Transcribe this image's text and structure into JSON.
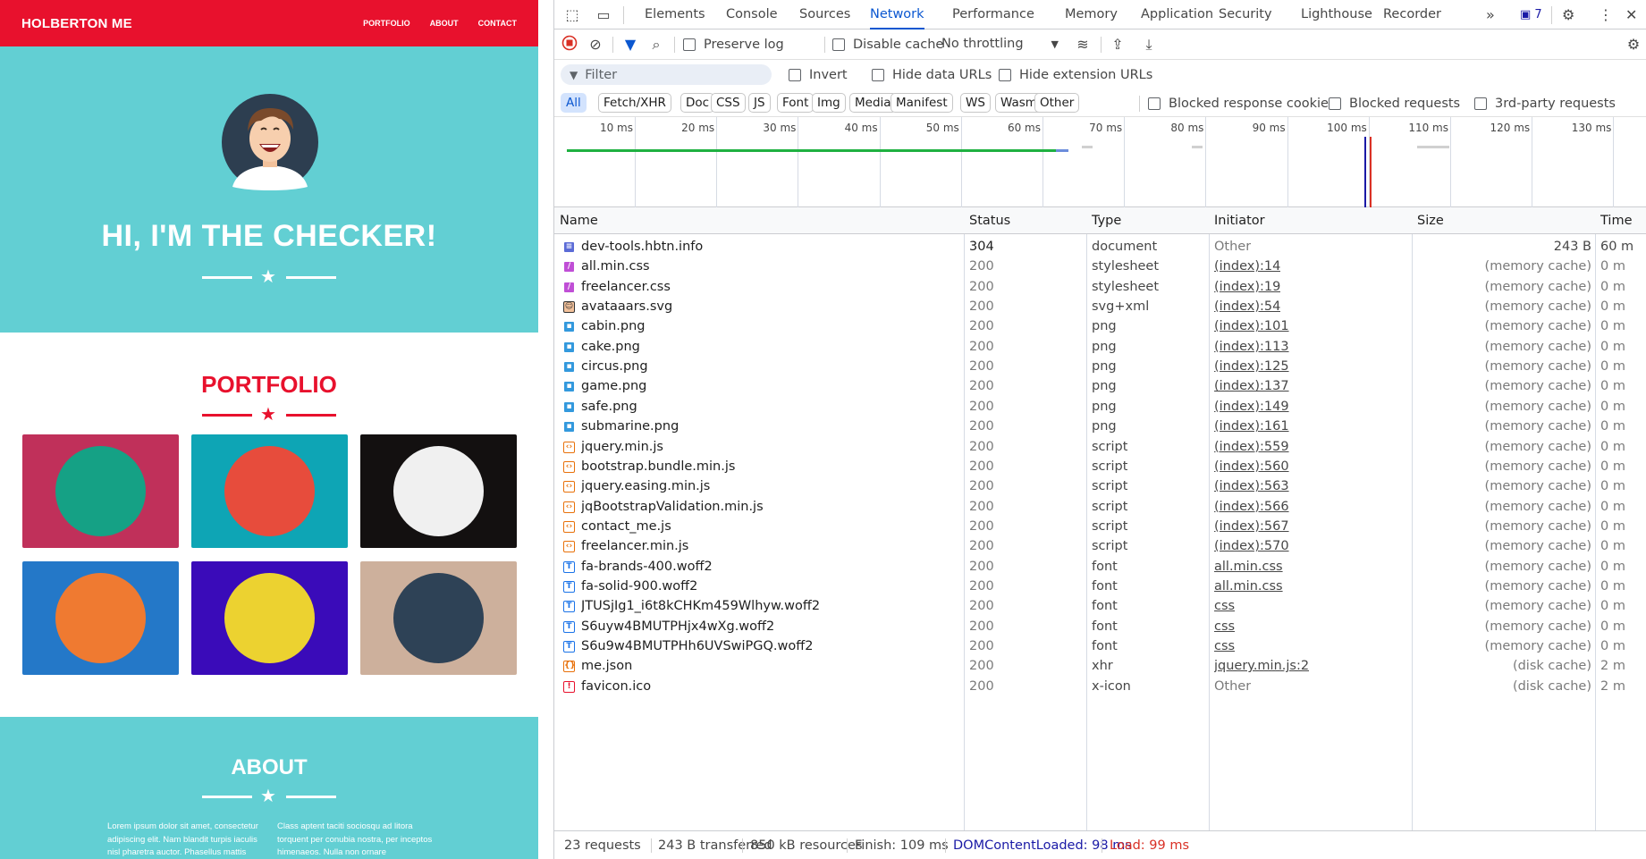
{
  "site": {
    "brand": "HOLBERTON ME",
    "nav": [
      "PORTFOLIO",
      "ABOUT",
      "CONTACT"
    ],
    "hero_title": "HI, I'M THE CHECKER!",
    "portfolio_title": "PORTFOLIO",
    "about_title": "ABOUT",
    "about_col1": "Lorem ipsum dolor sit amet, consectetur adipiscing elit. Nam blandit turpis iaculis nisl pharetra auctor. Phasellus mattis",
    "about_col2": "Class aptent taciti sociosqu ad litora torquent per conubia nostra, per inceptos himenaeos. Nulla non ornare",
    "colors": {
      "nav": "#e8112d",
      "teal": "#62cfd3",
      "accent": "#e8112d"
    },
    "tiles": [
      {
        "name": "cabin",
        "bg": "#c0305a",
        "circle": "#15a185"
      },
      {
        "name": "cake",
        "bg": "#0ea5b5",
        "circle": "#e74c3c"
      },
      {
        "name": "circus",
        "bg": "#131010",
        "circle": "#f0f0f0"
      },
      {
        "name": "game",
        "bg": "#2478c8",
        "circle": "#ef7a31"
      },
      {
        "name": "safe",
        "bg": "#3a0bb9",
        "circle": "#ecd230"
      },
      {
        "name": "submarine",
        "bg": "#cdb09c",
        "circle": "#2e4256"
      }
    ]
  },
  "devtools": {
    "tabs": [
      "Elements",
      "Console",
      "Sources",
      "Network",
      "Performance",
      "Memory",
      "Application",
      "Security",
      "Lighthouse",
      "Recorder"
    ],
    "active_tab": "Network",
    "issues_count": "7",
    "toolbar": {
      "preserve_log": "Preserve log",
      "disable_cache": "Disable cache",
      "throttling": "No throttling"
    },
    "filter": {
      "placeholder": "Filter",
      "invert": "Invert",
      "hide_data_urls": "Hide data URLs",
      "hide_extension_urls": "Hide extension URLs"
    },
    "types": [
      "All",
      "Fetch/XHR",
      "Doc",
      "CSS",
      "JS",
      "Font",
      "Img",
      "Media",
      "Manifest",
      "WS",
      "Wasm",
      "Other"
    ],
    "active_type": "All",
    "type_checks": {
      "blocked_cookies": "Blocked response cookies",
      "blocked_requests": "Blocked requests",
      "third_party": "3rd-party requests"
    },
    "timeline_ticks": [
      "10 ms",
      "20 ms",
      "30 ms",
      "40 ms",
      "50 ms",
      "60 ms",
      "70 ms",
      "80 ms",
      "90 ms",
      "100 ms",
      "110 ms",
      "120 ms",
      "130 ms"
    ],
    "columns": {
      "name": "Name",
      "status": "Status",
      "type": "Type",
      "initiator": "Initiator",
      "size": "Size",
      "time": "Time"
    },
    "requests": [
      {
        "kind": "doc",
        "name": "dev-tools.hbtn.info",
        "status": "304",
        "type": "document",
        "initiator": "Other",
        "size": "243 B",
        "time": "60 m"
      },
      {
        "kind": "css",
        "name": "all.min.css",
        "status": "200",
        "type": "stylesheet",
        "initiator": "(index):14",
        "size": "(memory cache)",
        "time": "0 m"
      },
      {
        "kind": "css",
        "name": "freelancer.css",
        "status": "200",
        "type": "stylesheet",
        "initiator": "(index):19",
        "size": "(memory cache)",
        "time": "0 m"
      },
      {
        "kind": "svg",
        "name": "avataaars.svg",
        "status": "200",
        "type": "svg+xml",
        "initiator": "(index):54",
        "size": "(memory cache)",
        "time": "0 m"
      },
      {
        "kind": "img",
        "name": "cabin.png",
        "status": "200",
        "type": "png",
        "initiator": "(index):101",
        "size": "(memory cache)",
        "time": "0 m"
      },
      {
        "kind": "img",
        "name": "cake.png",
        "status": "200",
        "type": "png",
        "initiator": "(index):113",
        "size": "(memory cache)",
        "time": "0 m"
      },
      {
        "kind": "img",
        "name": "circus.png",
        "status": "200",
        "type": "png",
        "initiator": "(index):125",
        "size": "(memory cache)",
        "time": "0 m"
      },
      {
        "kind": "img",
        "name": "game.png",
        "status": "200",
        "type": "png",
        "initiator": "(index):137",
        "size": "(memory cache)",
        "time": "0 m"
      },
      {
        "kind": "img",
        "name": "safe.png",
        "status": "200",
        "type": "png",
        "initiator": "(index):149",
        "size": "(memory cache)",
        "time": "0 m"
      },
      {
        "kind": "img",
        "name": "submarine.png",
        "status": "200",
        "type": "png",
        "initiator": "(index):161",
        "size": "(memory cache)",
        "time": "0 m"
      },
      {
        "kind": "js",
        "name": "jquery.min.js",
        "status": "200",
        "type": "script",
        "initiator": "(index):559",
        "size": "(memory cache)",
        "time": "0 m"
      },
      {
        "kind": "js",
        "name": "bootstrap.bundle.min.js",
        "status": "200",
        "type": "script",
        "initiator": "(index):560",
        "size": "(memory cache)",
        "time": "0 m"
      },
      {
        "kind": "js",
        "name": "jquery.easing.min.js",
        "status": "200",
        "type": "script",
        "initiator": "(index):563",
        "size": "(memory cache)",
        "time": "0 m"
      },
      {
        "kind": "js",
        "name": "jqBootstrapValidation.min.js",
        "status": "200",
        "type": "script",
        "initiator": "(index):566",
        "size": "(memory cache)",
        "time": "0 m"
      },
      {
        "kind": "js",
        "name": "contact_me.js",
        "status": "200",
        "type": "script",
        "initiator": "(index):567",
        "size": "(memory cache)",
        "time": "0 m"
      },
      {
        "kind": "js",
        "name": "freelancer.min.js",
        "status": "200",
        "type": "script",
        "initiator": "(index):570",
        "size": "(memory cache)",
        "time": "0 m"
      },
      {
        "kind": "font",
        "name": "fa-brands-400.woff2",
        "status": "200",
        "type": "font",
        "initiator": "all.min.css",
        "size": "(memory cache)",
        "time": "0 m"
      },
      {
        "kind": "font",
        "name": "fa-solid-900.woff2",
        "status": "200",
        "type": "font",
        "initiator": "all.min.css",
        "size": "(memory cache)",
        "time": "0 m"
      },
      {
        "kind": "font",
        "name": "JTUSjIg1_i6t8kCHKm459Wlhyw.woff2",
        "status": "200",
        "type": "font",
        "initiator": "css",
        "size": "(memory cache)",
        "time": "0 m"
      },
      {
        "kind": "font",
        "name": "S6uyw4BMUTPHjx4wXg.woff2",
        "status": "200",
        "type": "font",
        "initiator": "css",
        "size": "(memory cache)",
        "time": "0 m"
      },
      {
        "kind": "font",
        "name": "S6u9w4BMUTPHh6UVSwiPGQ.woff2",
        "status": "200",
        "type": "font",
        "initiator": "css",
        "size": "(memory cache)",
        "time": "0 m"
      },
      {
        "kind": "xhr",
        "name": "me.json",
        "status": "200",
        "type": "xhr",
        "initiator": "jquery.min.js:2",
        "size": "(disk cache)",
        "time": "2 m"
      },
      {
        "kind": "ico",
        "name": "favicon.ico",
        "status": "200",
        "type": "x-icon",
        "initiator": "Other",
        "size": "(disk cache)",
        "time": "2 m"
      }
    ],
    "summary": {
      "requests": "23 requests",
      "transferred": "243 B transferred",
      "resources": "850 kB resources",
      "finish": "Finish: 109 ms",
      "domcontentloaded": "DOMContentLoaded: 98 ms",
      "load": "Load: 99 ms"
    },
    "colors": {
      "active": "#0b57d0",
      "dcl": "#1a1aa6",
      "load": "#d93025",
      "bar_green": "#1fb141"
    }
  }
}
